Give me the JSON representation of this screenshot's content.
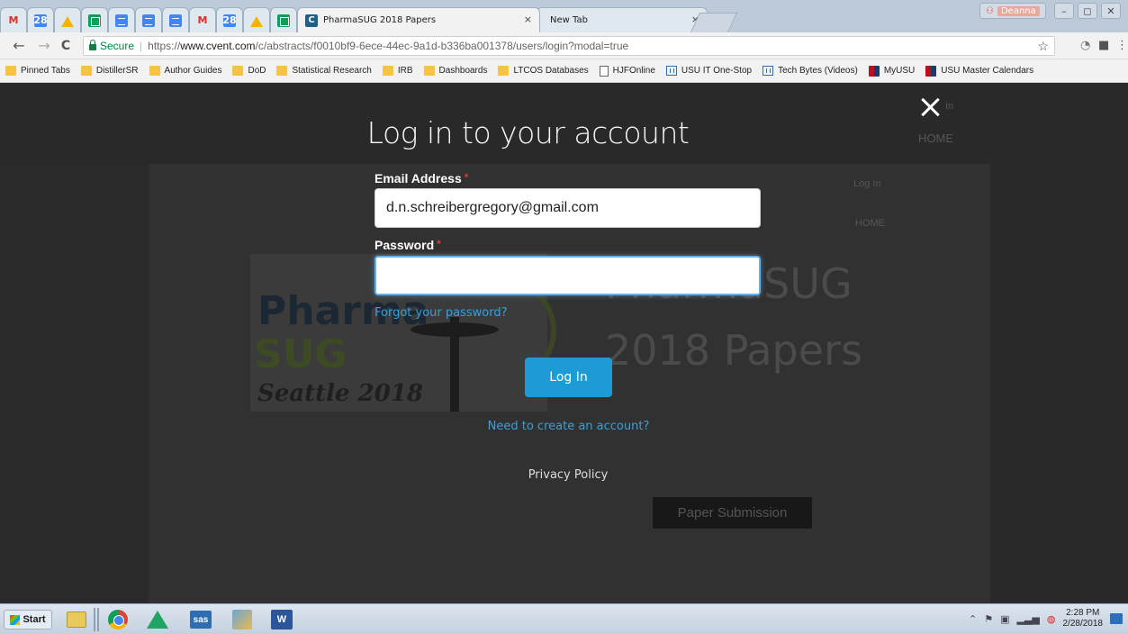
{
  "browser": {
    "tabs": [
      {
        "icon": "gmail-icon",
        "glyph": "M"
      },
      {
        "icon": "calendar-icon",
        "glyph": "28"
      },
      {
        "icon": "google-drive-icon",
        "glyph": ""
      },
      {
        "icon": "google-sheets-icon",
        "glyph": ""
      },
      {
        "icon": "google-docs-icon",
        "glyph": ""
      },
      {
        "icon": "google-docs-icon",
        "glyph": ""
      },
      {
        "icon": "google-docs-icon",
        "glyph": ""
      },
      {
        "icon": "gmail-icon",
        "glyph": "M"
      },
      {
        "icon": "calendar-icon",
        "glyph": "28"
      },
      {
        "icon": "google-drive-icon",
        "glyph": ""
      },
      {
        "icon": "google-sheets-icon",
        "glyph": ""
      }
    ],
    "active_tab": {
      "title": "PharmaSUG 2018 Papers",
      "close": "×",
      "icon_glyph": "C"
    },
    "new_tab": {
      "title": "New Tab",
      "close": "×"
    },
    "user_name": "Deanna",
    "window_buttons": [
      "–",
      "◻",
      "✕"
    ],
    "nav": {
      "back": "←",
      "forward": "→",
      "reload": "C"
    },
    "address": {
      "secure_label": "Secure",
      "separator": "|",
      "scheme": "https://",
      "host": "www.cvent.com",
      "path": "/c/abstracts/f0010bf9-6ece-44ec-9a1d-b336ba001378/users/login?modal=true"
    },
    "star": "☆",
    "bookmarks": [
      {
        "label": "Pinned Tabs",
        "icon": "folder-icon"
      },
      {
        "label": "DistillerSR",
        "icon": "folder-icon"
      },
      {
        "label": "Author Guides",
        "icon": "folder-icon"
      },
      {
        "label": "DoD",
        "icon": "folder-icon"
      },
      {
        "label": "Statistical Research",
        "icon": "folder-icon"
      },
      {
        "label": "IRB",
        "icon": "folder-icon"
      },
      {
        "label": "Dashboards",
        "icon": "folder-icon"
      },
      {
        "label": "LTCOS Databases",
        "icon": "folder-icon"
      },
      {
        "label": "HJFOnline",
        "icon": "page-icon"
      },
      {
        "label": "USU IT One-Stop",
        "icon": "usu-it-icon"
      },
      {
        "label": "Tech Bytes (Videos)",
        "icon": "usu-it-icon"
      },
      {
        "label": "MyUSU",
        "icon": "usu-logo-icon"
      },
      {
        "label": "USU Master Calendars",
        "icon": "usu-logo-icon"
      }
    ]
  },
  "page": {
    "background": {
      "logo_pharma": "Pharma",
      "logo_sug": "SUG",
      "logo_seattle": "Seattle 2018",
      "title_line1": "PharmaSUG",
      "title_line2": "2018 Papers",
      "nav_login_top": "In",
      "nav_home_top": "HOME",
      "nav_login": "Log In",
      "nav_home": "HOME",
      "paper_submission": "Paper Submission"
    },
    "modal": {
      "title": "Log in to your account",
      "email_label": "Email Address",
      "email_value": "d.n.schreibergregory@gmail.com",
      "password_label": "Password",
      "password_value": "",
      "required_mark": "*",
      "forgot_link": "Forgot your password?",
      "login_button": "Log In",
      "create_account_link": "Need to create an account?",
      "privacy_link": "Privacy Policy"
    }
  },
  "taskbar": {
    "start_label": "Start",
    "apps": [
      "file-explorer-icon",
      "chrome-icon",
      "google-drive-icon",
      "sas-icon",
      "tool-icon",
      "word-icon"
    ],
    "sas_label": "sas",
    "word_label": "W",
    "clock_time": "2:28 PM",
    "clock_date": "2/28/2018"
  },
  "colors": {
    "accent": "#1e9ad6",
    "link": "#3aa0d8",
    "required": "#e0393e",
    "overlay": "#292929"
  }
}
